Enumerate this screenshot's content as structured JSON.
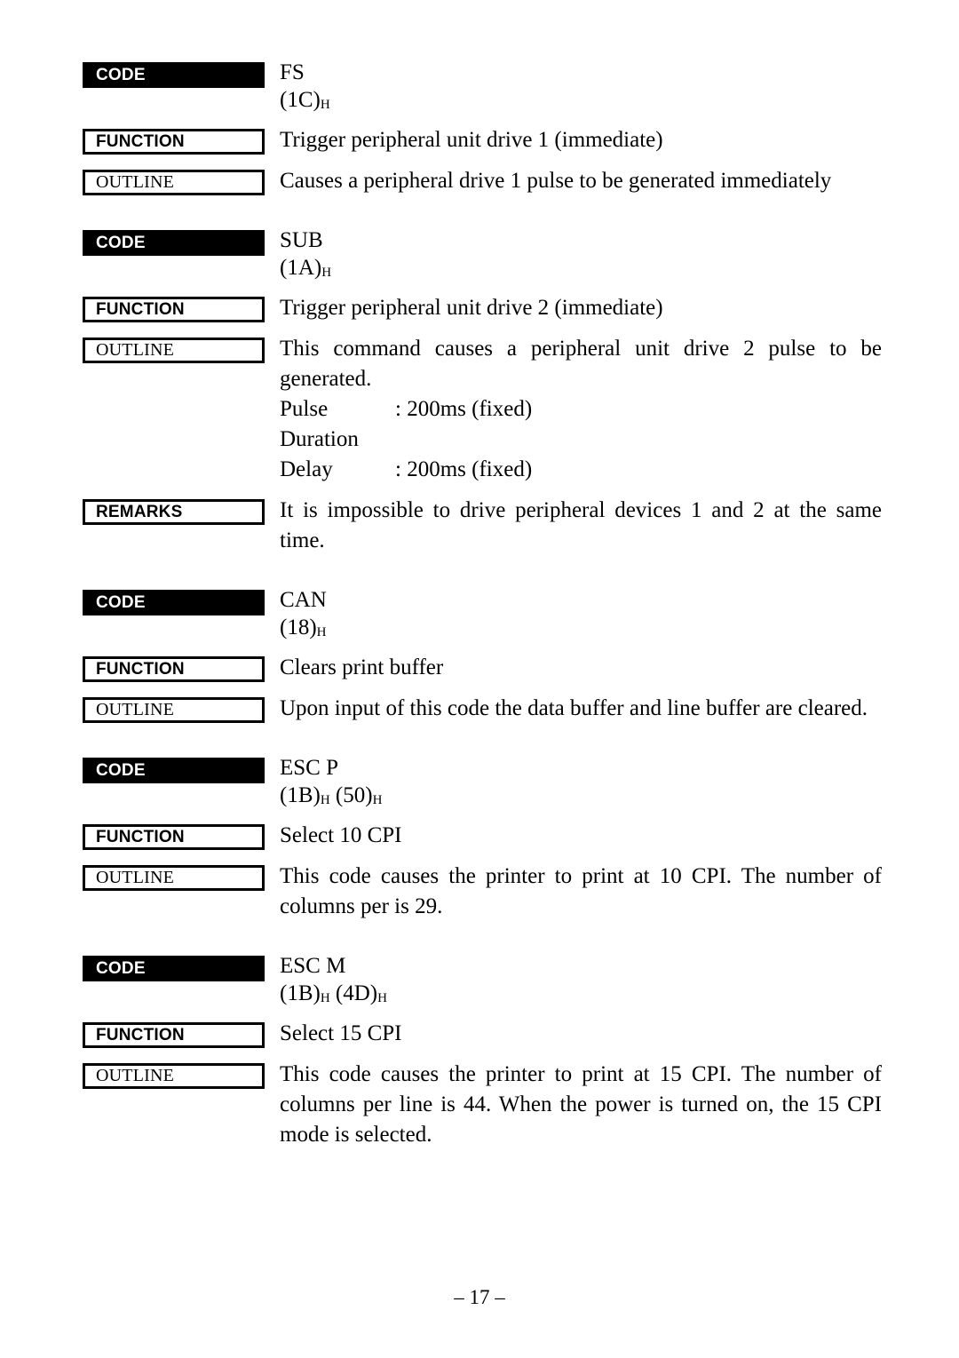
{
  "page": {
    "footer": "– 17 –"
  },
  "labels": {
    "code": "CODE",
    "function": "FUNCTION",
    "outline": "OUTLINE",
    "remarks": "REMARKS"
  },
  "blocks": [
    {
      "mnemonic": "FS",
      "hex": "(1C)",
      "hex_sub": "H",
      "function": "Trigger peripheral unit drive 1 (immediate)",
      "outline": "Causes a peripheral drive 1 pulse to be generated immediately"
    },
    {
      "mnemonic": "SUB",
      "hex": "(1A)",
      "hex_sub": "H",
      "function": "Trigger peripheral unit drive 2 (immediate)",
      "outline": "This command causes a peripheral unit drive 2 pulse to be generated.",
      "outline_pairs": [
        {
          "key": "Pulse Duration",
          "value": ": 200ms (fixed)"
        },
        {
          "key": "Delay",
          "value": ": 200ms (fixed)"
        }
      ],
      "remarks": "It is impossible to drive peripheral devices 1 and 2 at the same time."
    },
    {
      "mnemonic": "CAN",
      "hex": "(18)",
      "hex_sub": "H",
      "function": "Clears print buffer",
      "outline": "Upon input of this code the data buffer and line buffer are cleared."
    },
    {
      "mnemonic": "ESC P",
      "hex": "(1B)",
      "hex_sub": "H",
      "hex2": "(50)",
      "hex2_sub": "H",
      "function": "Select 10 CPI",
      "outline": "This code causes the printer to print at 10 CPI. The number of columns per is 29."
    },
    {
      "mnemonic": "ESC M",
      "hex": "(1B)",
      "hex_sub": "H",
      "hex2": "(4D)",
      "hex2_sub": "H",
      "function": "Select 15 CPI",
      "outline": "This code causes the printer to print at 15 CPI. The number of columns per line is 44. When the power is turned on, the 15 CPI mode is selected."
    }
  ]
}
